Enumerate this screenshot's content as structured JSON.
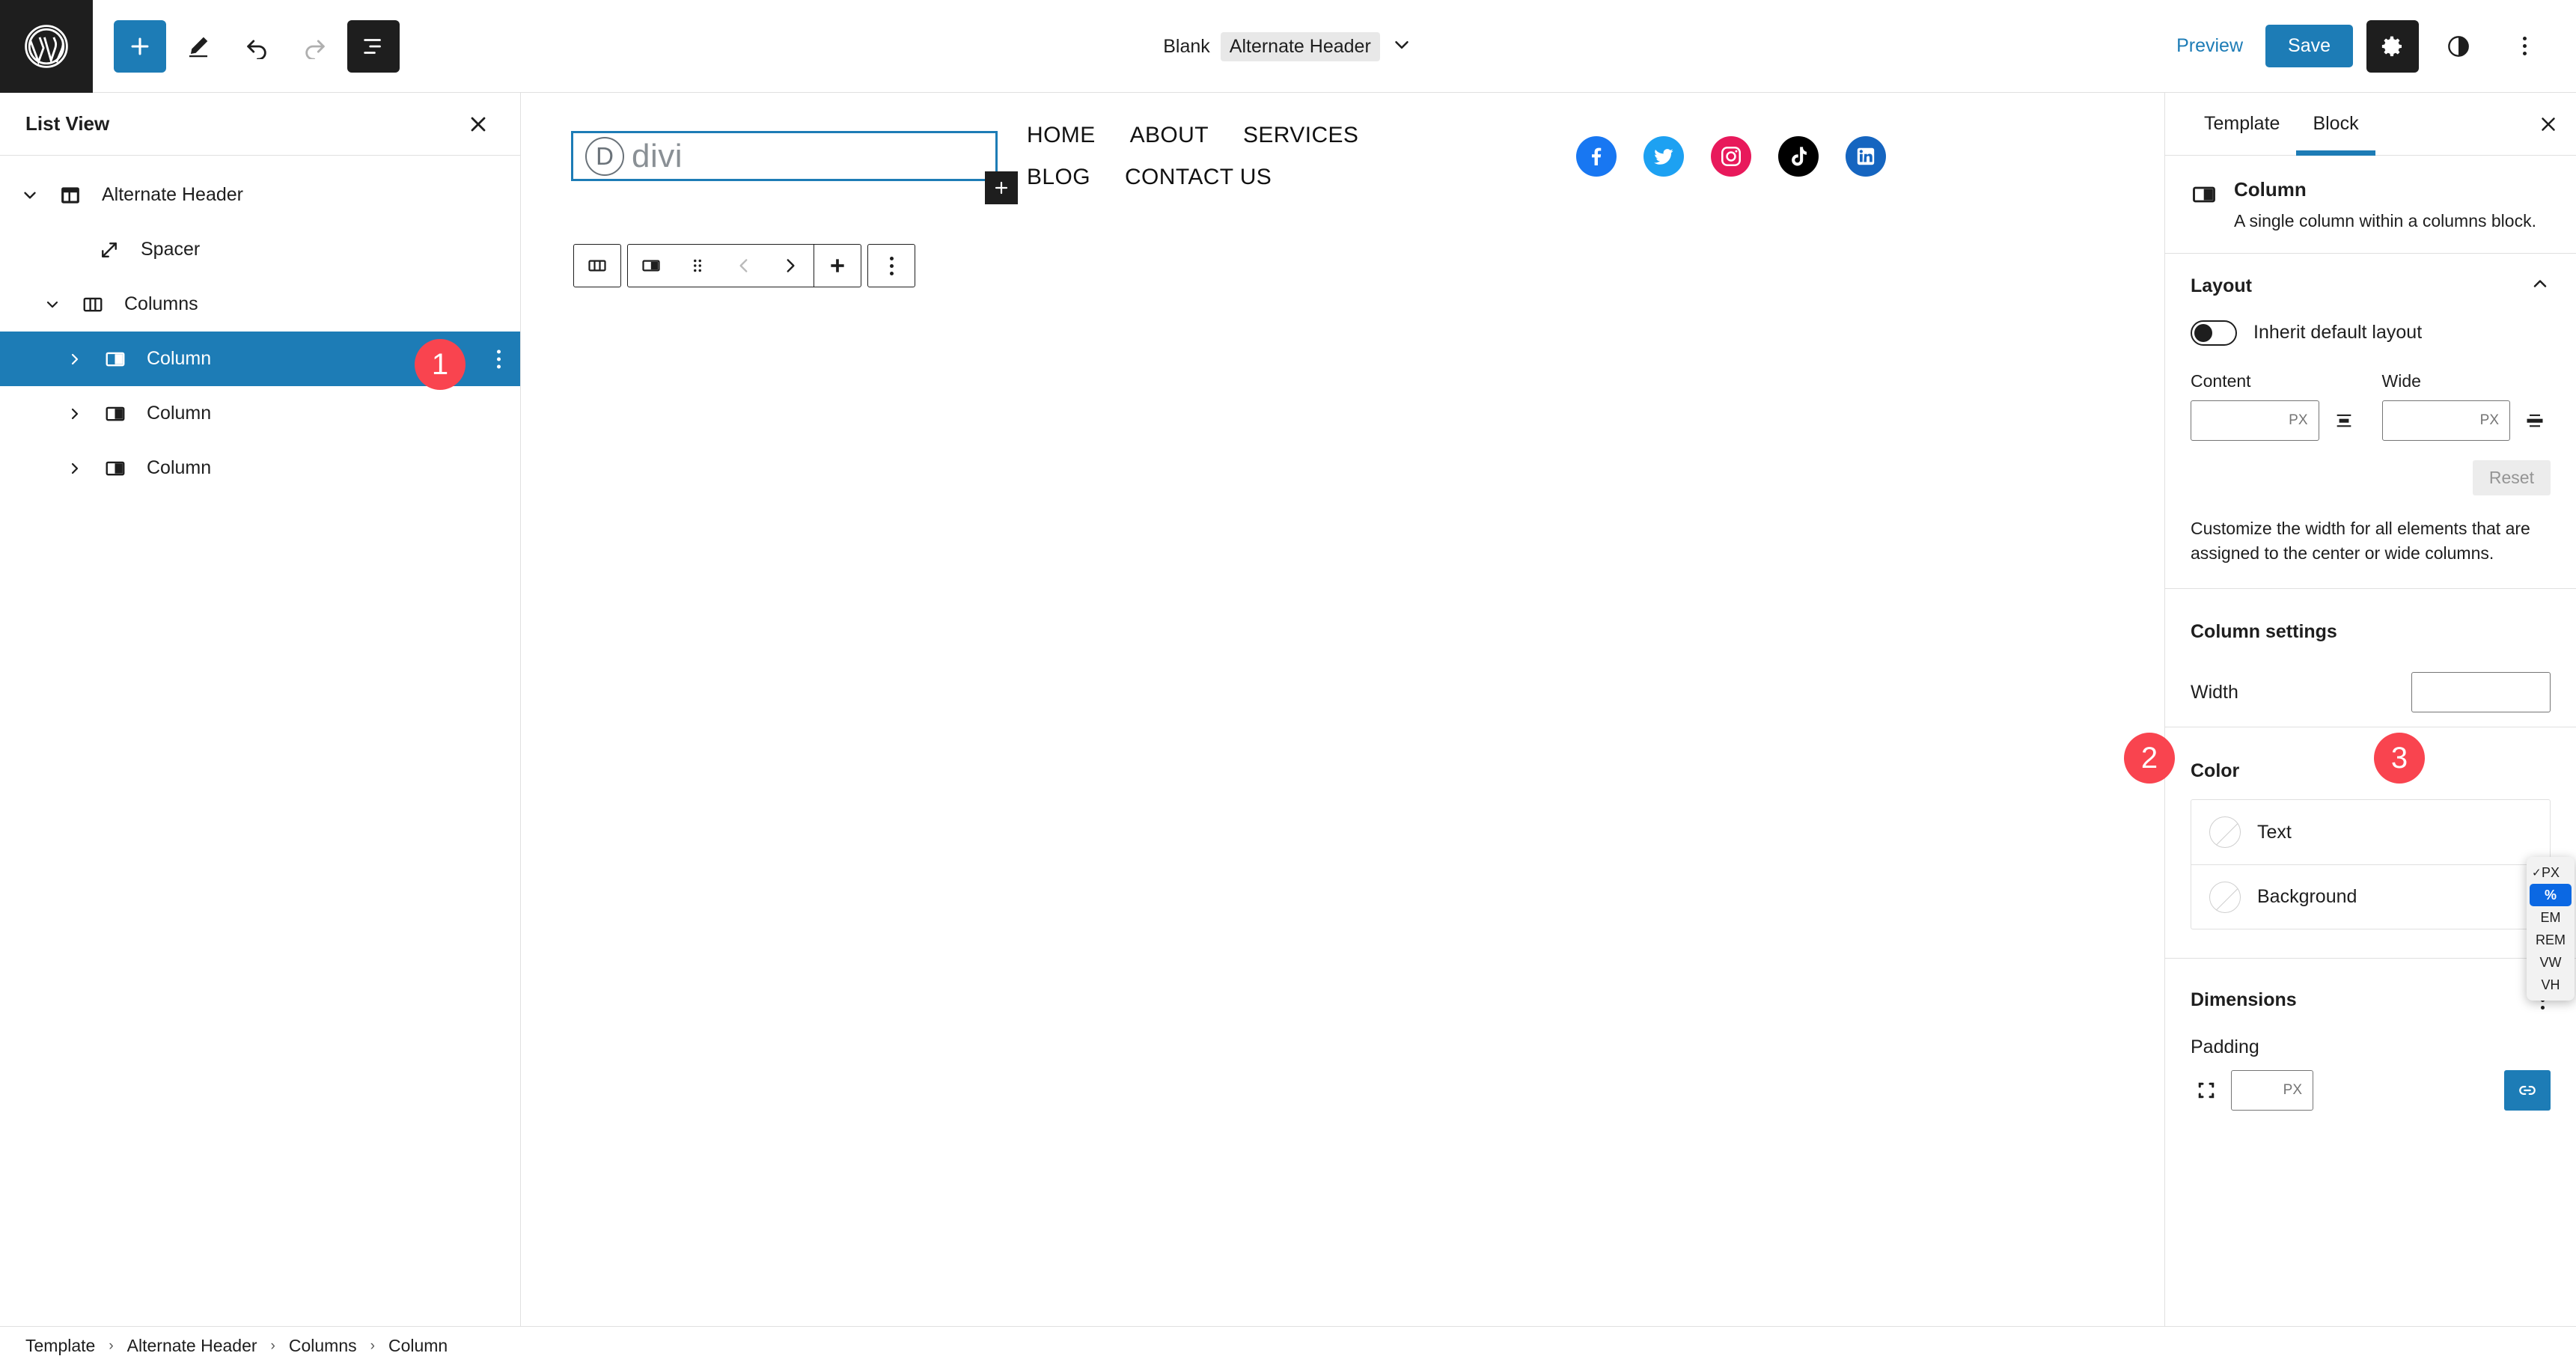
{
  "topbar": {
    "logo_icon": "wordpress-logo-icon",
    "add_block_label": "+",
    "tools": [
      "add-block",
      "edit-pencil",
      "undo",
      "redo",
      "list-view"
    ],
    "document_prefix": "Blank",
    "document_title": "Alternate Header",
    "preview_label": "Preview",
    "save_label": "Save",
    "accent_color": "#1d7cb6"
  },
  "listview": {
    "title": "List View",
    "items": [
      {
        "label": "Alternate Header",
        "icon": "template-part-icon",
        "depth": 0,
        "expanded": true,
        "selected": false
      },
      {
        "label": "Spacer",
        "icon": "spacer-icon",
        "depth": 1,
        "expanded": false,
        "selected": false
      },
      {
        "label": "Columns",
        "icon": "columns-icon",
        "depth": 1,
        "expanded": true,
        "selected": false
      },
      {
        "label": "Column",
        "icon": "column-icon",
        "depth": 2,
        "expanded": false,
        "selected": true
      },
      {
        "label": "Column",
        "icon": "column-icon",
        "depth": 2,
        "expanded": false,
        "selected": false
      },
      {
        "label": "Column",
        "icon": "column-icon",
        "depth": 2,
        "expanded": false,
        "selected": false
      }
    ]
  },
  "canvas": {
    "logo": {
      "mark": "D",
      "word": "divi"
    },
    "nav_rows": [
      [
        "HOME",
        "ABOUT",
        "SERVICES"
      ],
      [
        "BLOG",
        "CONTACT US"
      ]
    ],
    "socials": [
      {
        "name": "facebook",
        "color": "#1877F2"
      },
      {
        "name": "twitter",
        "color": "#1DA1F2"
      },
      {
        "name": "instagram",
        "color": "#E8195B"
      },
      {
        "name": "tiktok",
        "color": "#000000"
      },
      {
        "name": "linkedin",
        "color": "#1565C0"
      }
    ],
    "toolbar_buttons": [
      "select-parent-columns",
      "column-block",
      "drag-handle",
      "move-left",
      "move-right",
      "add-block",
      "options"
    ]
  },
  "inspector": {
    "tabs": [
      {
        "label": "Template",
        "active": false
      },
      {
        "label": "Block",
        "active": true
      }
    ],
    "block": {
      "title": "Column",
      "description": "A single column within a columns block."
    },
    "layout": {
      "heading": "Layout",
      "inherit_label": "Inherit default layout",
      "inherit_on": false,
      "content_label": "Content",
      "content_value": "",
      "content_unit": "PX",
      "wide_label": "Wide",
      "wide_value": "",
      "wide_unit": "PX",
      "reset_label": "Reset",
      "help_text": "Customize the width for all elements that are assigned to the center or wide columns."
    },
    "column_settings": {
      "heading": "Column settings",
      "width_label": "Width",
      "width_value": "",
      "unit_menu": {
        "options": [
          "PX",
          "%",
          "EM",
          "REM",
          "VW",
          "VH"
        ],
        "checked": "PX",
        "highlighted": "%"
      }
    },
    "color": {
      "heading": "Color",
      "items": [
        {
          "label": "Text"
        },
        {
          "label": "Background"
        }
      ]
    },
    "dimensions": {
      "heading": "Dimensions",
      "padding_label": "Padding",
      "padding_value": "",
      "padding_unit": "PX"
    }
  },
  "breadcrumb": {
    "items": [
      "Template",
      "Alternate Header",
      "Columns",
      "Column"
    ],
    "separator": "›"
  },
  "badges": [
    {
      "number": "1"
    },
    {
      "number": "2"
    },
    {
      "number": "3"
    }
  ]
}
